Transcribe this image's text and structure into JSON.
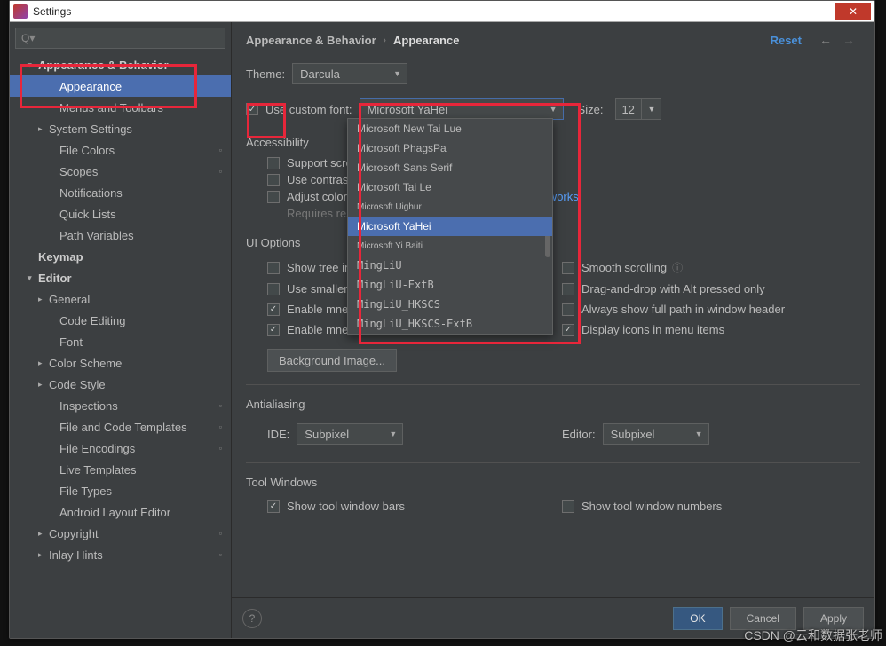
{
  "window": {
    "title": "Settings",
    "close_glyph": "✕"
  },
  "search": {
    "placeholder": "Q▾"
  },
  "sidebar": [
    {
      "label": "Appearance & Behavior",
      "level": "l1",
      "chev": "▾"
    },
    {
      "label": "Appearance",
      "level": "l2",
      "selected": true
    },
    {
      "label": "Menus and Toolbars",
      "level": "l2"
    },
    {
      "label": "System Settings",
      "level": "l2c",
      "chev": "▸"
    },
    {
      "label": "File Colors",
      "level": "l2",
      "proj": true
    },
    {
      "label": "Scopes",
      "level": "l2",
      "proj": true
    },
    {
      "label": "Notifications",
      "level": "l2"
    },
    {
      "label": "Quick Lists",
      "level": "l2"
    },
    {
      "label": "Path Variables",
      "level": "l2"
    },
    {
      "label": "Keymap",
      "level": "l1"
    },
    {
      "label": "Editor",
      "level": "l1",
      "chev": "▾"
    },
    {
      "label": "General",
      "level": "l2c",
      "chev": "▸"
    },
    {
      "label": "Code Editing",
      "level": "l2"
    },
    {
      "label": "Font",
      "level": "l2"
    },
    {
      "label": "Color Scheme",
      "level": "l2c",
      "chev": "▸"
    },
    {
      "label": "Code Style",
      "level": "l2c",
      "chev": "▸"
    },
    {
      "label": "Inspections",
      "level": "l2",
      "proj": true
    },
    {
      "label": "File and Code Templates",
      "level": "l2",
      "proj": true
    },
    {
      "label": "File Encodings",
      "level": "l2",
      "proj": true
    },
    {
      "label": "Live Templates",
      "level": "l2"
    },
    {
      "label": "File Types",
      "level": "l2"
    },
    {
      "label": "Android Layout Editor",
      "level": "l2"
    },
    {
      "label": "Copyright",
      "level": "l2c",
      "chev": "▸",
      "proj": true
    },
    {
      "label": "Inlay Hints",
      "level": "l2c",
      "chev": "▸",
      "proj": true
    }
  ],
  "breadcrumb": {
    "root": "Appearance & Behavior",
    "leaf": "Appearance",
    "reset": "Reset",
    "back": "←",
    "fwd": "→"
  },
  "theme": {
    "label": "Theme:",
    "value": "Darcula"
  },
  "font": {
    "chk_label": "Use custom font:",
    "value": "Microsoft YaHei",
    "size_label": "Size:",
    "size_value": "12"
  },
  "fontOptions": [
    {
      "label": "Microsoft New Tai Lue"
    },
    {
      "label": "Microsoft PhagsPa"
    },
    {
      "label": "Microsoft Sans Serif"
    },
    {
      "label": "Microsoft Tai Le"
    },
    {
      "label": "Microsoft Uighur",
      "small": true
    },
    {
      "label": "Microsoft YaHei",
      "sel": true
    },
    {
      "label": "Microsoft Yi Baiti",
      "small": true
    },
    {
      "label": "MingLiU",
      "mono": true
    },
    {
      "label": "MingLiU-ExtB",
      "mono": true
    },
    {
      "label": "MingLiU_HKSCS",
      "mono": true
    },
    {
      "label": "MingLiU_HKSCS-ExtB",
      "mono": true
    }
  ],
  "accessibility": {
    "title": "Accessibility",
    "c1": "Support screen readers",
    "c2": "Use contrast scrollbars",
    "c3a": "Adjust colors for red-green vision deficiency ",
    "c3b": "How it works",
    "c3c": "Requires restart"
  },
  "ui": {
    "title": "UI Options",
    "r1a": "Show tree indent guides",
    "r1b": "Smooth scrolling",
    "r2a": "Use smaller indents in trees",
    "r2b": "Drag-and-drop with Alt pressed only",
    "r3a": "Enable mnemonics in menu",
    "r3b": "Always show full path in window header",
    "r4a": "Enable mnemonics in controls",
    "r4b": "Display icons in menu items",
    "bg": "Background Image..."
  },
  "aa": {
    "title": "Antialiasing",
    "ide": "IDE:",
    "ide_v": "Subpixel",
    "ed": "Editor:",
    "ed_v": "Subpixel"
  },
  "tw": {
    "title": "Tool Windows",
    "c1": "Show tool window bars",
    "c2": "Show tool window numbers"
  },
  "footer": {
    "ok": "OK",
    "cancel": "Cancel",
    "apply": "Apply",
    "help": "?"
  },
  "watermark": "CSDN @云和数据张老师"
}
